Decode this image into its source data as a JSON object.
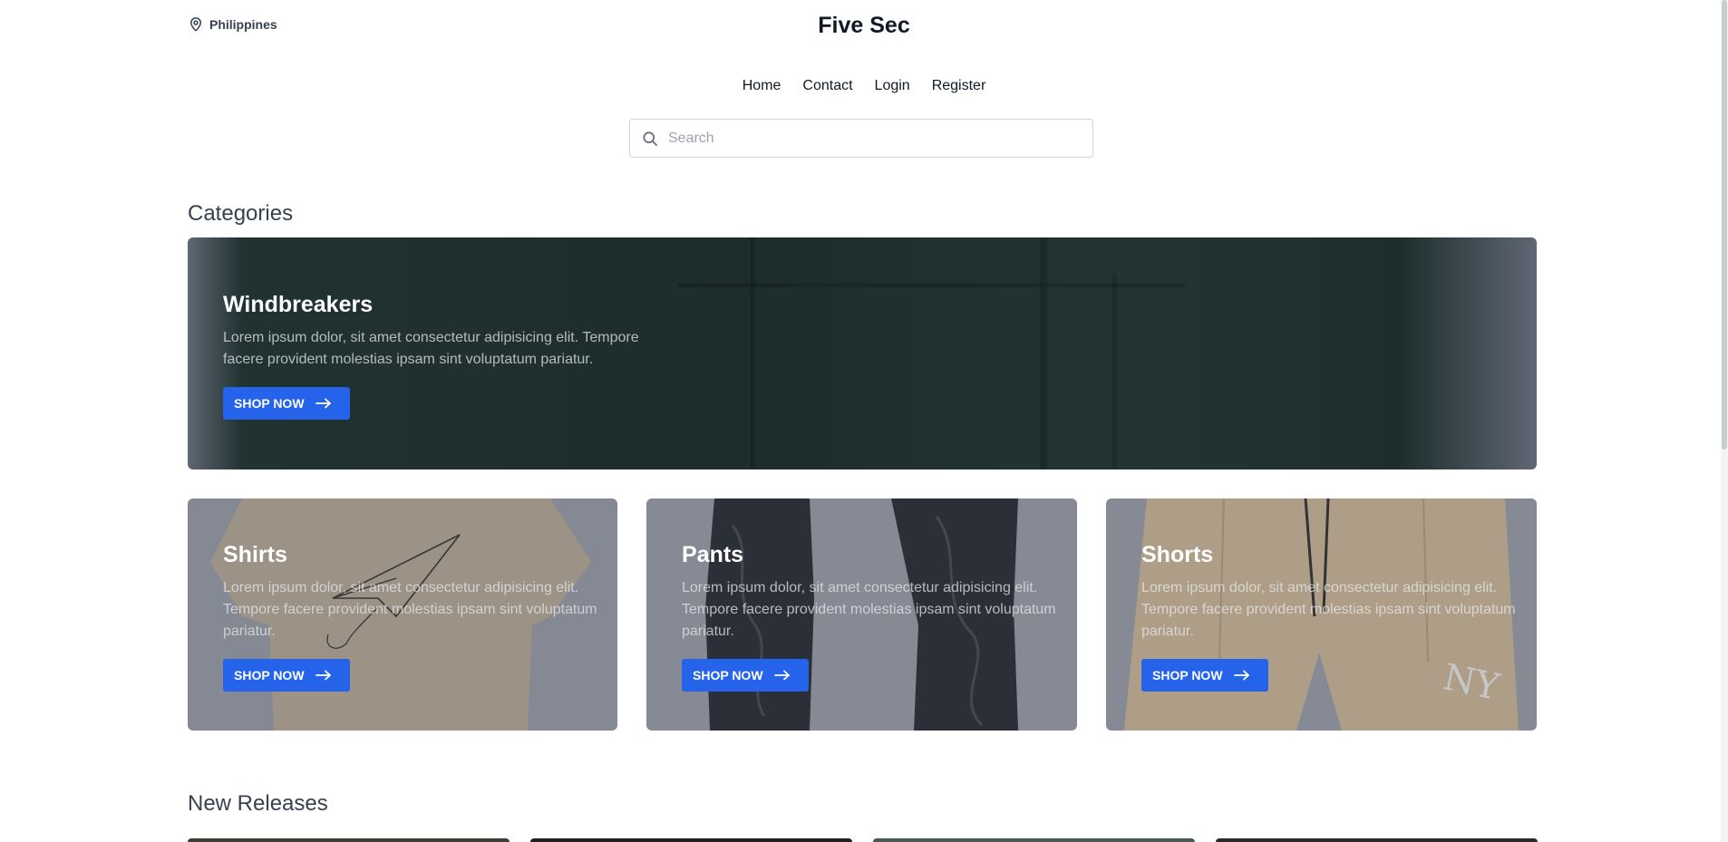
{
  "header": {
    "location": "Philippines",
    "brand": "Five Sec"
  },
  "nav": {
    "items": [
      "Home",
      "Contact",
      "Login",
      "Register"
    ]
  },
  "search": {
    "placeholder": "Search",
    "value": ""
  },
  "categories": {
    "title": "Categories",
    "featured": {
      "title": "Windbreakers",
      "description": "Lorem ipsum dolor, sit amet consectetur adipisicing elit. Tempore facere provident molestias ipsam sint voluptatum pariatur.",
      "button": "SHOP NOW"
    },
    "items": [
      {
        "title": "Shirts",
        "description": "Lorem ipsum dolor, sit amet consectetur adipisicing elit. Tempore facere provident molestias ipsam sint voluptatum pariatur.",
        "button": "SHOP NOW"
      },
      {
        "title": "Pants",
        "description": "Lorem ipsum dolor, sit amet consectetur adipisicing elit. Tempore facere provident molestias ipsam sint voluptatum pariatur.",
        "button": "SHOP NOW"
      },
      {
        "title": "Shorts",
        "description": "Lorem ipsum dolor, sit amet consectetur adipisicing elit. Tempore facere provident molestias ipsam sint voluptatum pariatur.",
        "button": "SHOP NOW",
        "print": "NY"
      }
    ]
  },
  "new_releases": {
    "title": "New Releases"
  },
  "colors": {
    "accent": "#2563eb",
    "heading": "#374151",
    "overlay": "#8a8e98"
  }
}
